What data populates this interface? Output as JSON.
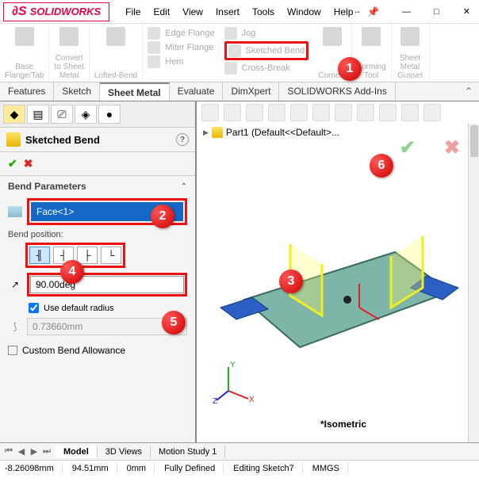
{
  "app_name": "SOLIDWORKS",
  "menus": [
    "File",
    "Edit",
    "View",
    "Insert",
    "Tools",
    "Window",
    "Help"
  ],
  "ribbon": {
    "groups": [
      {
        "label": "Base\nFlange/Tab"
      },
      {
        "label": "Convert\nto Sheet\nMetal"
      },
      {
        "label": "Lofted-Bend"
      }
    ],
    "sub": [
      {
        "label": "Edge Flange"
      },
      {
        "label": "Miter Flange"
      },
      {
        "label": "Hem"
      },
      {
        "label": "Jog"
      },
      {
        "label": "Sketched Bend"
      },
      {
        "label": "Cross-Break"
      }
    ],
    "right_groups": [
      {
        "label": "Corners"
      },
      {
        "label": "Forming\nTool"
      },
      {
        "label": "Sheet\nMetal\nGusset"
      }
    ]
  },
  "tabs": [
    "Features",
    "Sketch",
    "Sheet Metal",
    "Evaluate",
    "DimXpert",
    "SOLIDWORKS Add-Ins"
  ],
  "active_tab": "Sheet Metal",
  "panel": {
    "title": "Sketched Bend",
    "section": "Bend Parameters",
    "face_sel": "Face<1>",
    "bend_pos_label": "Bend position:",
    "angle": "90.00deg",
    "use_default_radius": "Use default radius",
    "radius": "0.73660mm",
    "custom_allow": "Custom Bend Allowance"
  },
  "tree": {
    "part": "Part1  (Default<<Default>..."
  },
  "iso_label": "*Isometric",
  "bottom_tabs": [
    "Model",
    "3D Views",
    "Motion Study 1"
  ],
  "status": {
    "x": "-8.26098mm",
    "y": "94.51mm",
    "z": "0mm",
    "def": "Fully Defined",
    "edit": "Editing Sketch7",
    "units": "MMGS"
  },
  "triad": {
    "x": "X",
    "y": "Y",
    "z": "Z"
  }
}
